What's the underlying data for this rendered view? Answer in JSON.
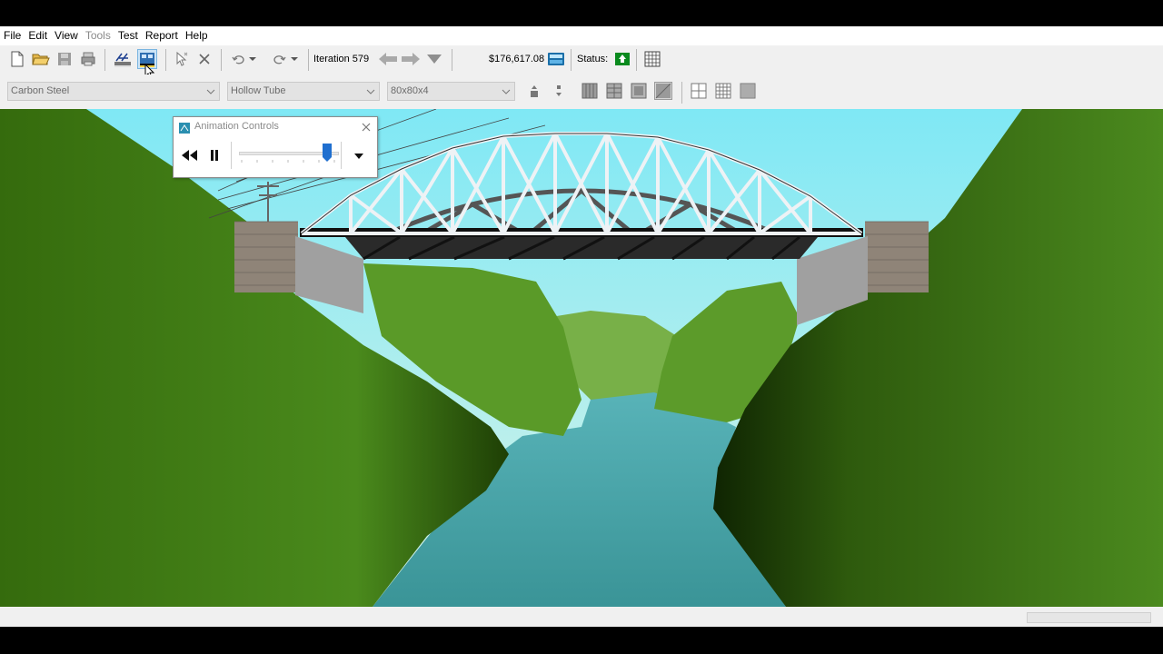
{
  "menu": {
    "items": [
      {
        "label": "File",
        "enabled": true
      },
      {
        "label": "Edit",
        "enabled": true
      },
      {
        "label": "View",
        "enabled": true
      },
      {
        "label": "Tools",
        "enabled": false
      },
      {
        "label": "Test",
        "enabled": true
      },
      {
        "label": "Report",
        "enabled": true
      },
      {
        "label": "Help",
        "enabled": true
      }
    ]
  },
  "toolbar": {
    "iteration_label": "Iteration 579",
    "cost": "$176,617.08",
    "status_label": "Status:",
    "status_color": "#0a8a1e",
    "pressed_button": "load-test-button"
  },
  "properties": {
    "material": "Carbon Steel",
    "section": "Hollow Tube",
    "size": "80x80x4"
  },
  "animation": {
    "title": "Animation Controls",
    "speed_fraction": 0.92
  },
  "colors": {
    "sky": "#7fe7f3",
    "hills": "#3f7a14",
    "river": "#3f9a9a",
    "pressed": "#cce4f7"
  }
}
